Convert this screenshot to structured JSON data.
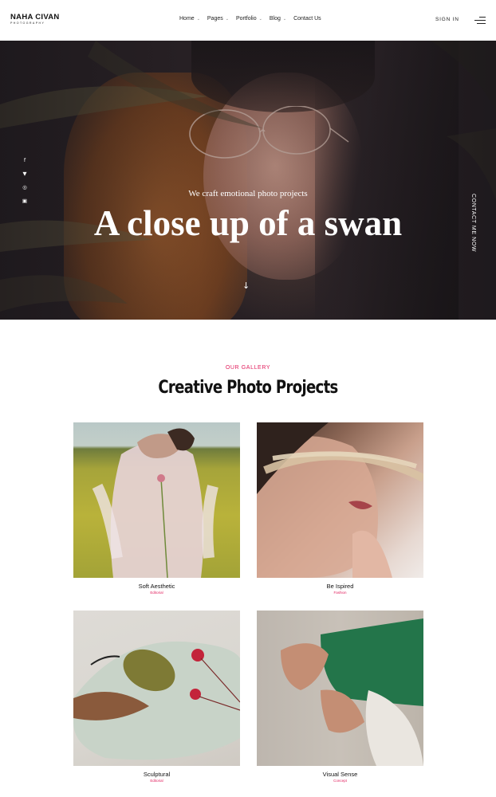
{
  "brand": {
    "name": "NAHA CIVAN",
    "tagline": "PHOTOGRAPHY"
  },
  "nav": {
    "items": [
      {
        "label": "Home",
        "has_dropdown": true
      },
      {
        "label": "Pages",
        "has_dropdown": true
      },
      {
        "label": "Portfolio",
        "has_dropdown": true
      },
      {
        "label": "Blog",
        "has_dropdown": true
      },
      {
        "label": "Contact Us",
        "has_dropdown": false
      }
    ],
    "signin_label": "SIGN IN",
    "menu_icon": "hamburger-menu-icon"
  },
  "hero": {
    "subtitle": "We craft emotional photo projects",
    "title": "A close up of a swan",
    "social_icons": [
      "facebook-icon",
      "twitter-icon",
      "dribbble-icon",
      "instagram-icon"
    ],
    "scroll_icon": "arrow-down-icon",
    "contact_label": "CONTACT ME NOW"
  },
  "gallery": {
    "eyebrow": "OUR GALLERY",
    "title": "Creative Photo Projects",
    "items": [
      {
        "name": "Soft Aesthetic",
        "category": "Editorial"
      },
      {
        "name": "Be Ispired",
        "category": "Fashion"
      },
      {
        "name": "Sculptural",
        "category": "Editorial"
      },
      {
        "name": "Visual Sense",
        "category": "Concept"
      }
    ]
  },
  "colors": {
    "accent": "#e11d5c",
    "text": "#111111",
    "background": "#ffffff"
  }
}
